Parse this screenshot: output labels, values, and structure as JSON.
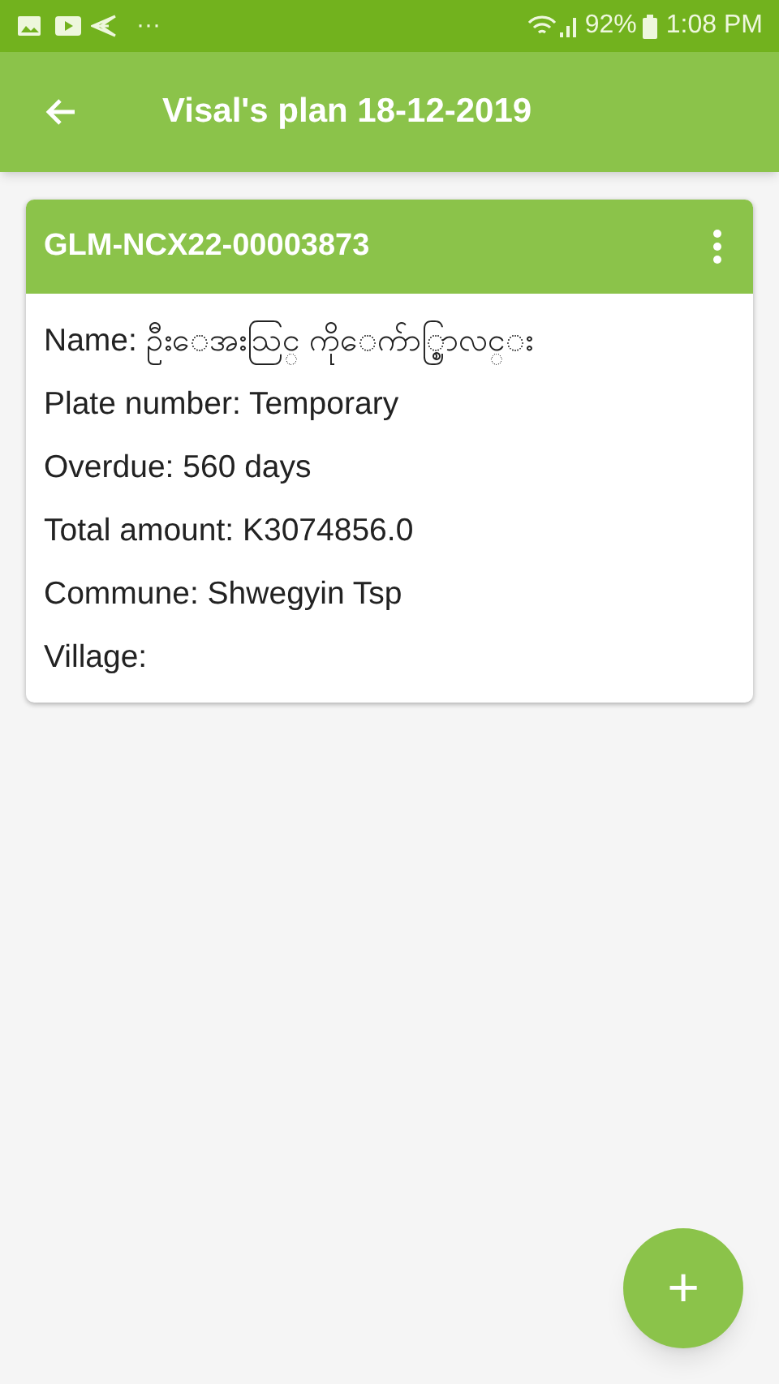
{
  "status_bar": {
    "dots": "···",
    "battery": "92%",
    "time": "1:08 PM"
  },
  "app_bar": {
    "title": "Visal's plan 18-12-2019"
  },
  "card": {
    "title": "GLM-NCX22-00003873",
    "fields": [
      {
        "label": "Name:",
        "value": "ဦးေအးသြင္ ကိုေက်ာ္စြာလင္း"
      },
      {
        "label": "Plate number:",
        "value": "Temporary"
      },
      {
        "label": "Overdue:",
        "value": "560 days"
      },
      {
        "label": "Total amount:",
        "value": "K3074856.0"
      },
      {
        "label": "Commune:",
        "value": "Shwegyin Tsp"
      },
      {
        "label": "Village:"
      }
    ]
  },
  "fab": {
    "label": "+"
  }
}
